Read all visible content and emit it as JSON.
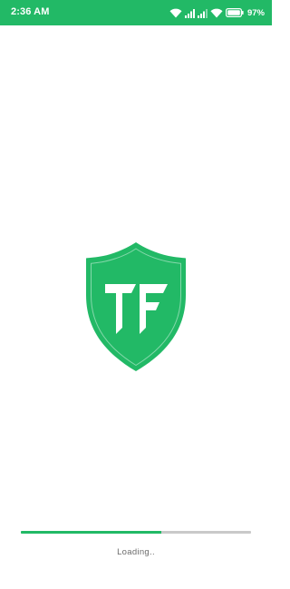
{
  "status_bar": {
    "time": "2:36 AM",
    "battery": "97",
    "background": "#22b966",
    "icons": [
      "wifi-icon",
      "signal-icon",
      "signal-icon",
      "wifi-icon",
      "battery-icon"
    ]
  },
  "logo": {
    "shield_color": "#22b966",
    "monogram_color": "#ffffff",
    "icon": "shield-tf-logo"
  },
  "loading": {
    "text": "Loading..",
    "progress_percent": 61,
    "track_color": "#c9c9c9",
    "fill_color": "#22b966"
  }
}
